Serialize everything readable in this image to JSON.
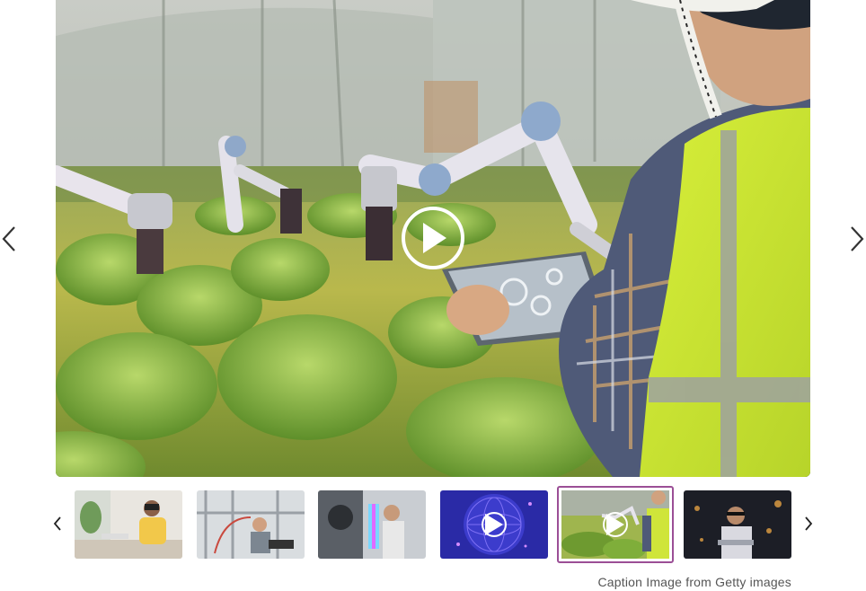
{
  "carousel": {
    "prev_icon": "chevron-left-icon",
    "next_icon": "chevron-right-icon",
    "play_icon": "play-circle-icon",
    "selected_index": 4,
    "accent_color": "#9b4f96"
  },
  "thumbnails": [
    {
      "subject": "VR headset user at desk",
      "has_video": false
    },
    {
      "subject": "Engineer in robotics lab",
      "has_video": false
    },
    {
      "subject": "Scientist with DNA hologram",
      "has_video": false
    },
    {
      "subject": "Blue network globe",
      "has_video": true
    },
    {
      "subject": "Robotic arms in greenhouse",
      "has_video": true
    },
    {
      "subject": "Woman with laptop at night",
      "has_video": false
    }
  ],
  "caption": {
    "text": "Caption Image from Getty images"
  }
}
